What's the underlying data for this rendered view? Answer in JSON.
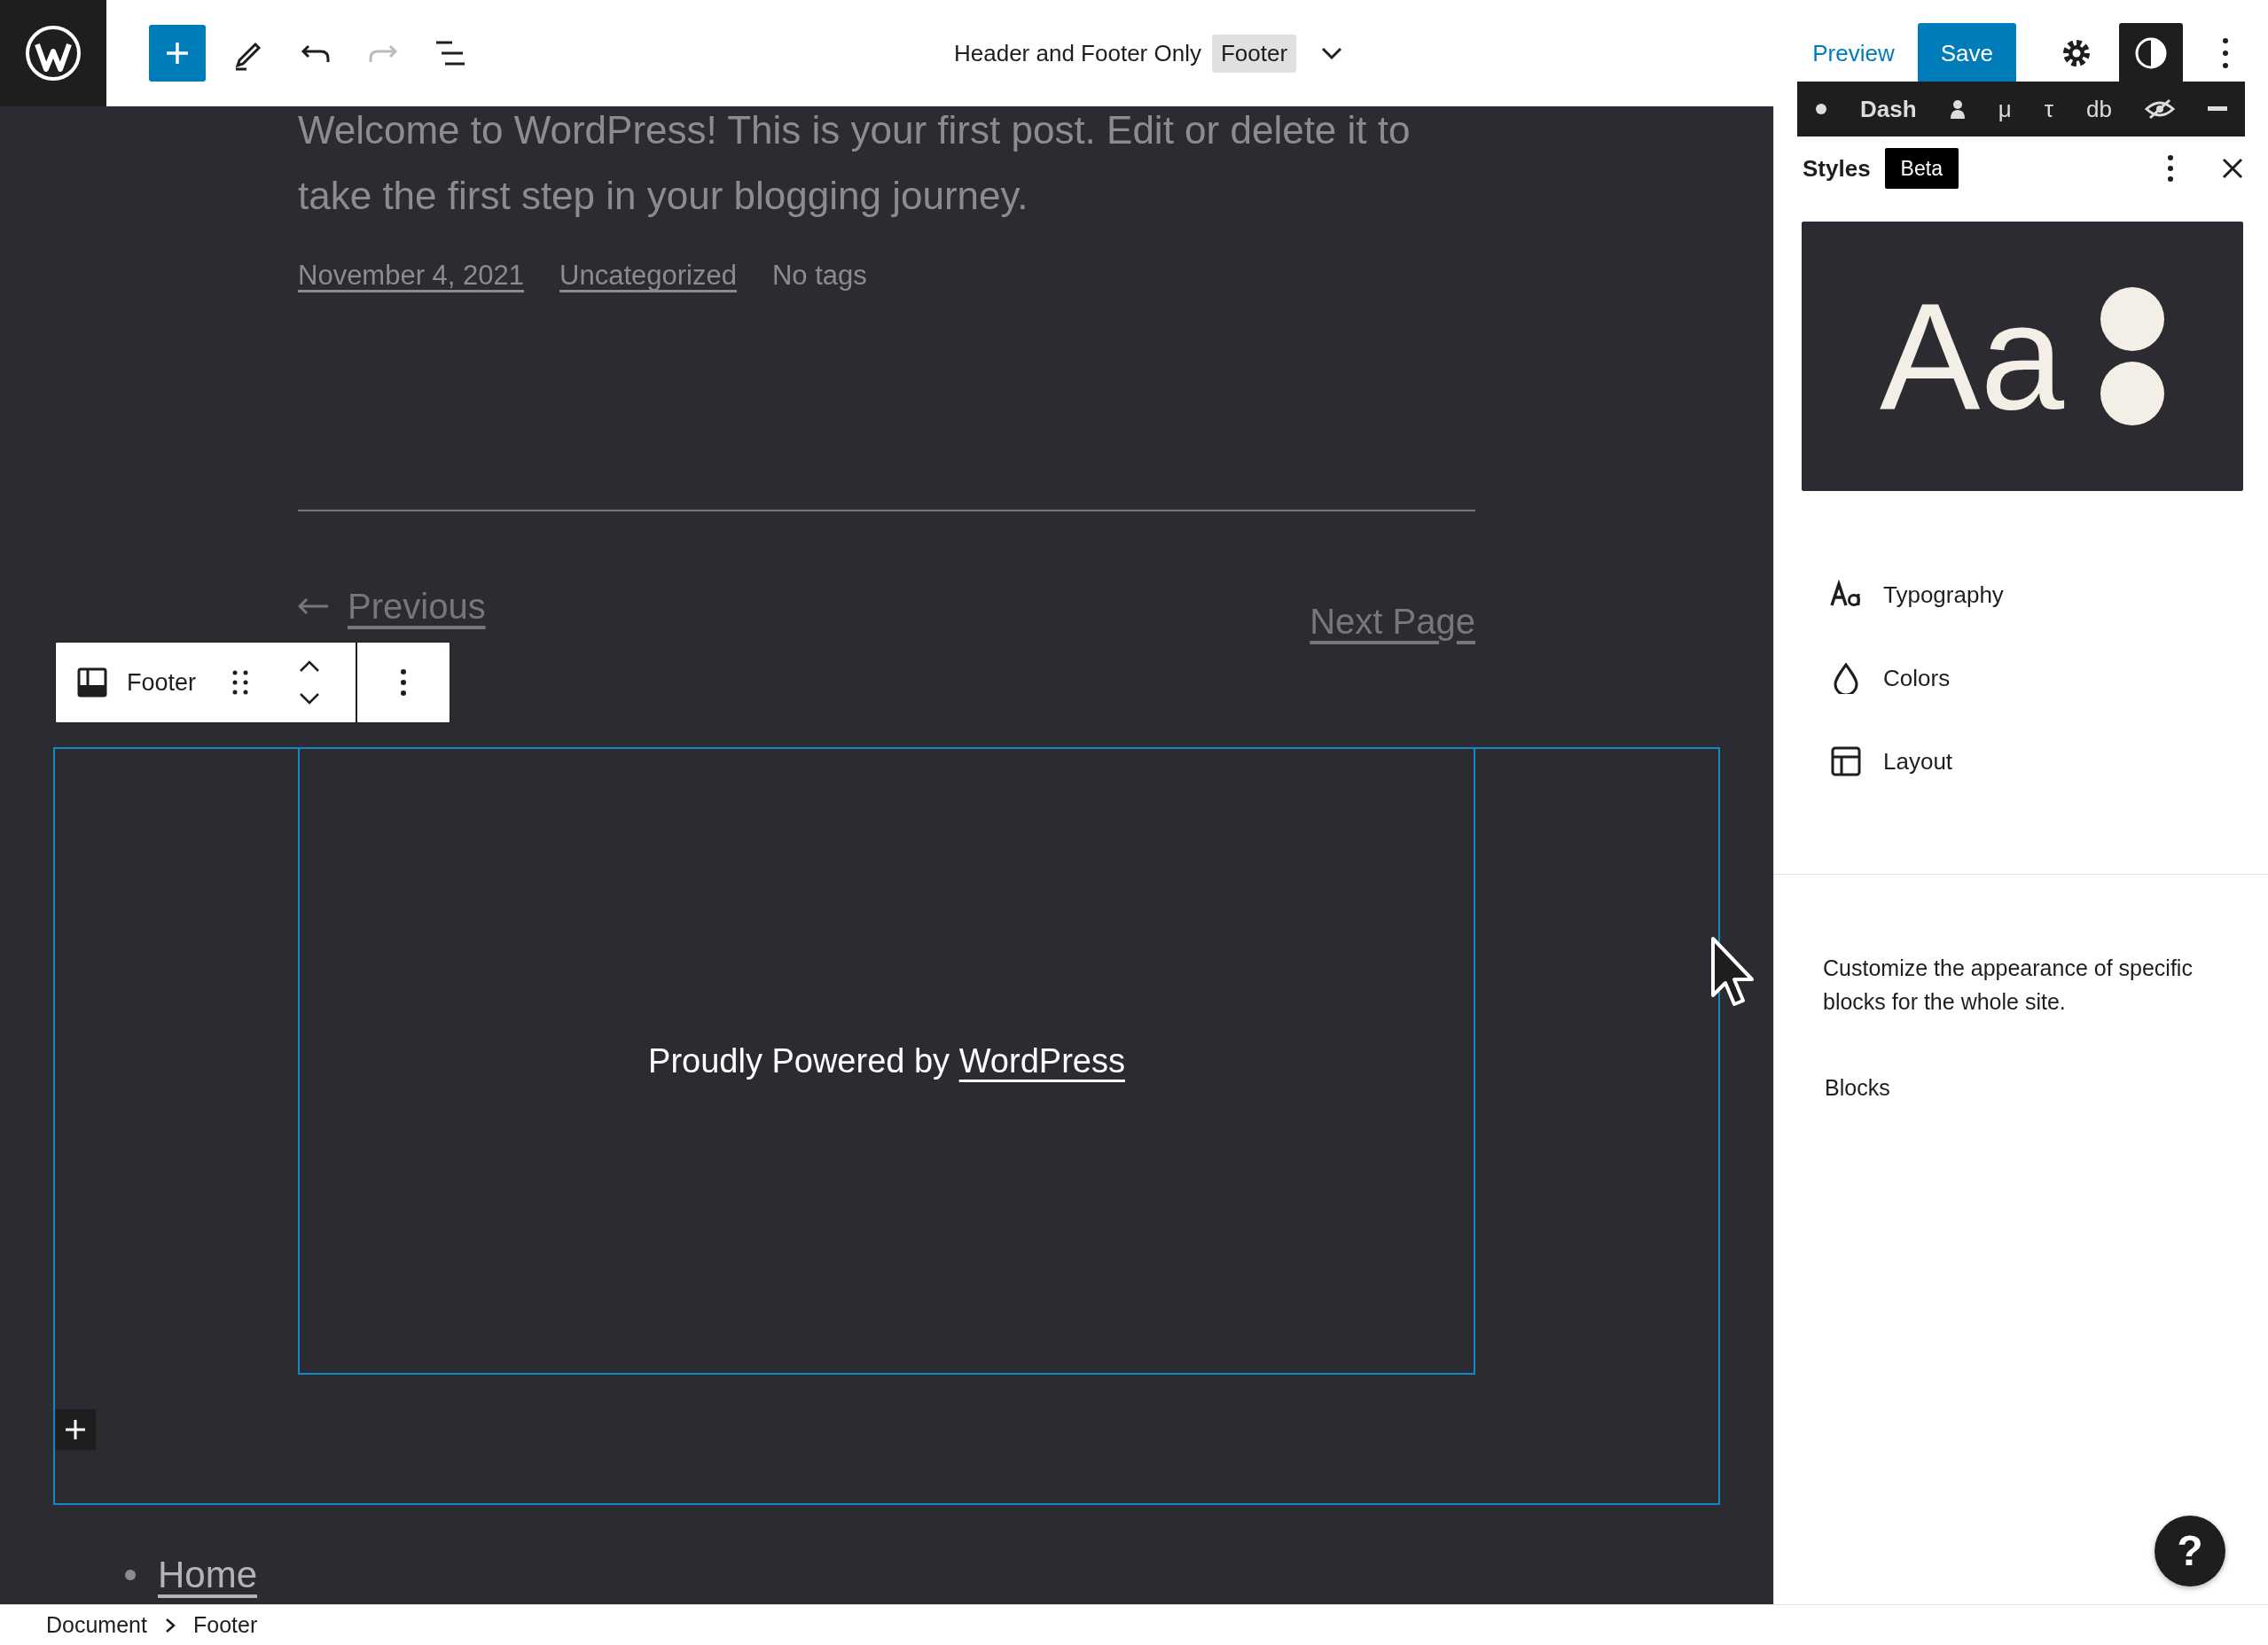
{
  "topbar": {
    "title": "Header and Footer Only",
    "template": "Footer",
    "preview": "Preview",
    "save": "Save",
    "styles_selected": true
  },
  "dev_toolbar": {
    "labels": [
      "Dash",
      "μ",
      "τ",
      "db"
    ]
  },
  "post": {
    "excerpt": "Welcome to WordPress! This is your first post. Edit or delete it to take the first step in your blogging journey.",
    "date": "November 4, 2021",
    "category": "Uncategorized",
    "tags": "No tags",
    "previous": "Previous",
    "next": "Next Page"
  },
  "block_toolbar": {
    "label": "Footer"
  },
  "footer": {
    "text": "Proudly Powered by ",
    "link": "WordPress"
  },
  "nav": [
    "Home"
  ],
  "sidebar": {
    "title": "Styles",
    "badge": "Beta",
    "preview_text": "Aa",
    "items": [
      {
        "label": "Typography"
      },
      {
        "label": "Colors"
      },
      {
        "label": "Layout"
      }
    ],
    "description": "Customize the appearance of specific blocks for the whole site.",
    "blocks_label": "Blocks"
  },
  "help": "?",
  "breadcrumb": [
    "Document",
    "Footer"
  ]
}
